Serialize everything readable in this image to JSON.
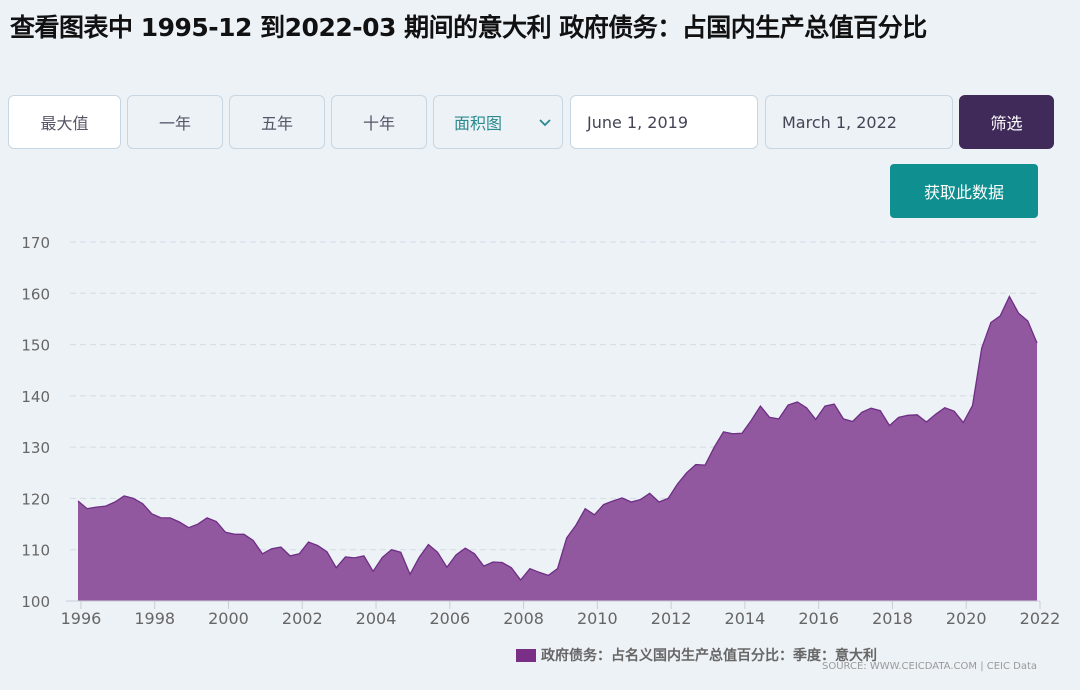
{
  "title": "查看图表中 1995-12 到2022-03 期间的意大利 政府债务：占国内生产总值百分比",
  "toolbar": {
    "max": "最大值",
    "one_year": "一年",
    "five_year": "五年",
    "ten_year": "十年",
    "chart_type": "面积图",
    "start_date": "June 1, 2019",
    "end_date": "March 1, 2022",
    "filter": "筛选"
  },
  "fetch_label": "获取此数据",
  "legend_label": "政府债务：占名义国内生产总值百分比：季度：意大利",
  "source_label": "SOURCE: WWW.CEICDATA.COM | CEIC Data",
  "colors": {
    "area": "#8c4f9a",
    "line": "#6e2e85",
    "legend": "#7a2f86",
    "filter": "#3f2a59",
    "fetch": "#0f8f8f"
  },
  "icons": {
    "chart_type_select": "chevron-down-icon"
  },
  "chart_data": {
    "type": "area",
    "xlabel": "",
    "ylabel": "",
    "ylim": [
      100,
      170
    ],
    "yticks": [
      100,
      110,
      120,
      130,
      140,
      150,
      160,
      170
    ],
    "xticks": [
      "1996",
      "1998",
      "2000",
      "2002",
      "2004",
      "2006",
      "2008",
      "2010",
      "2012",
      "2014",
      "2016",
      "2018",
      "2020",
      "2022"
    ],
    "grid": true,
    "legend_position": "bottom",
    "series": [
      {
        "name": "政府债务：占名义国内生产总值百分比：季度：意大利",
        "points": [
          [
            1995.92,
            119.5
          ],
          [
            1996.17,
            118.0
          ],
          [
            1996.42,
            118.3
          ],
          [
            1996.67,
            118.5
          ],
          [
            1996.92,
            119.3
          ],
          [
            1997.17,
            120.5
          ],
          [
            1997.42,
            120.0
          ],
          [
            1997.67,
            119.0
          ],
          [
            1997.92,
            117.0
          ],
          [
            1998.17,
            116.2
          ],
          [
            1998.42,
            116.2
          ],
          [
            1998.67,
            115.4
          ],
          [
            1998.92,
            114.3
          ],
          [
            1999.17,
            115.0
          ],
          [
            1999.42,
            116.2
          ],
          [
            1999.67,
            115.5
          ],
          [
            1999.92,
            113.4
          ],
          [
            2000.17,
            113.0
          ],
          [
            2000.42,
            113.0
          ],
          [
            2000.67,
            111.8
          ],
          [
            2000.92,
            109.2
          ],
          [
            2001.17,
            110.2
          ],
          [
            2001.42,
            110.5
          ],
          [
            2001.67,
            108.8
          ],
          [
            2001.92,
            109.2
          ],
          [
            2002.17,
            111.5
          ],
          [
            2002.42,
            110.8
          ],
          [
            2002.67,
            109.6
          ],
          [
            2002.92,
            106.5
          ],
          [
            2003.17,
            108.6
          ],
          [
            2003.42,
            108.4
          ],
          [
            2003.67,
            108.8
          ],
          [
            2003.92,
            105.8
          ],
          [
            2004.17,
            108.5
          ],
          [
            2004.42,
            110.0
          ],
          [
            2004.67,
            109.5
          ],
          [
            2004.92,
            105.2
          ],
          [
            2005.17,
            108.5
          ],
          [
            2005.42,
            111.0
          ],
          [
            2005.67,
            109.5
          ],
          [
            2005.92,
            106.6
          ],
          [
            2006.17,
            109.0
          ],
          [
            2006.42,
            110.3
          ],
          [
            2006.67,
            109.2
          ],
          [
            2006.92,
            106.8
          ],
          [
            2007.17,
            107.6
          ],
          [
            2007.42,
            107.5
          ],
          [
            2007.67,
            106.5
          ],
          [
            2007.92,
            104.1
          ],
          [
            2008.17,
            106.3
          ],
          [
            2008.42,
            105.6
          ],
          [
            2008.67,
            105.0
          ],
          [
            2008.92,
            106.3
          ],
          [
            2009.17,
            112.3
          ],
          [
            2009.42,
            114.8
          ],
          [
            2009.67,
            118.0
          ],
          [
            2009.92,
            116.8
          ],
          [
            2010.17,
            118.8
          ],
          [
            2010.42,
            119.5
          ],
          [
            2010.67,
            120.1
          ],
          [
            2010.92,
            119.3
          ],
          [
            2011.17,
            119.8
          ],
          [
            2011.42,
            121.0
          ],
          [
            2011.67,
            119.3
          ],
          [
            2011.92,
            120.0
          ],
          [
            2012.17,
            122.8
          ],
          [
            2012.42,
            125.0
          ],
          [
            2012.67,
            126.6
          ],
          [
            2012.92,
            126.5
          ],
          [
            2013.17,
            130.0
          ],
          [
            2013.42,
            133.0
          ],
          [
            2013.67,
            132.6
          ],
          [
            2013.92,
            132.7
          ],
          [
            2014.17,
            135.2
          ],
          [
            2014.42,
            138.0
          ],
          [
            2014.67,
            135.8
          ],
          [
            2014.92,
            135.5
          ],
          [
            2015.17,
            138.2
          ],
          [
            2015.42,
            138.8
          ],
          [
            2015.67,
            137.7
          ],
          [
            2015.92,
            135.4
          ],
          [
            2016.17,
            138.0
          ],
          [
            2016.42,
            138.4
          ],
          [
            2016.67,
            135.5
          ],
          [
            2016.92,
            135.0
          ],
          [
            2017.17,
            136.8
          ],
          [
            2017.42,
            137.6
          ],
          [
            2017.67,
            137.1
          ],
          [
            2017.92,
            134.2
          ],
          [
            2018.17,
            135.8
          ],
          [
            2018.42,
            136.2
          ],
          [
            2018.67,
            136.3
          ],
          [
            2018.92,
            134.9
          ],
          [
            2019.17,
            136.4
          ],
          [
            2019.42,
            137.7
          ],
          [
            2019.67,
            137.0
          ],
          [
            2019.92,
            134.8
          ],
          [
            2020.17,
            138.1
          ],
          [
            2020.42,
            149.3
          ],
          [
            2020.67,
            154.3
          ],
          [
            2020.92,
            155.6
          ],
          [
            2021.17,
            159.4
          ],
          [
            2021.42,
            156.1
          ],
          [
            2021.67,
            154.6
          ],
          [
            2021.92,
            150.3
          ]
        ]
      }
    ]
  }
}
